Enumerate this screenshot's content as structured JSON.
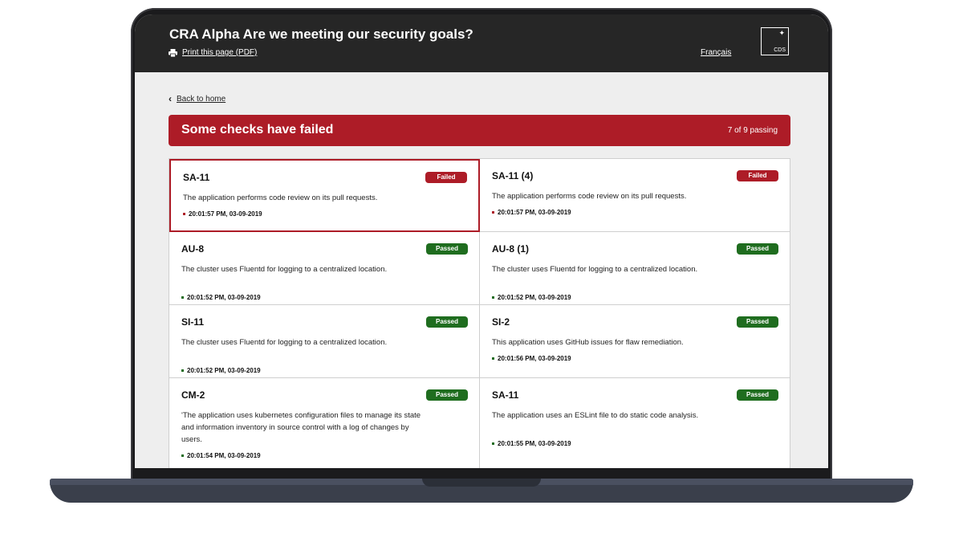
{
  "header": {
    "title": "CRA Alpha Are we meeting our security goals?",
    "print_label": "Print this page (PDF)",
    "language_link": "Français",
    "logo_text": "CDS"
  },
  "nav": {
    "back_label": "Back to home"
  },
  "banner": {
    "title": "Some checks have failed",
    "count": "7 of 9 passing",
    "color": "#ad1c27"
  },
  "status_colors": {
    "failed": "#ad1c27",
    "passed": "#1f6d1f"
  },
  "checks": [
    {
      "name": "SA-11",
      "status": "Failed",
      "description": "The application performs code review on its pull requests.",
      "timestamp": "20:01:57 PM, 03-09-2019"
    },
    {
      "name": "SA-11 (4)",
      "status": "Failed",
      "description": "The application performs code review on its pull requests.",
      "timestamp": "20:01:57 PM, 03-09-2019"
    },
    {
      "name": "AU-8",
      "status": "Passed",
      "description": "The cluster uses Fluentd for logging to a centralized location.",
      "timestamp": "20:01:52 PM, 03-09-2019"
    },
    {
      "name": "AU-8 (1)",
      "status": "Passed",
      "description": "The cluster uses Fluentd for logging to a centralized location.",
      "timestamp": "20:01:52 PM, 03-09-2019"
    },
    {
      "name": "SI-11",
      "status": "Passed",
      "description": "The cluster uses Fluentd for logging to a centralized location.",
      "timestamp": "20:01:52 PM, 03-09-2019"
    },
    {
      "name": "SI-2",
      "status": "Passed",
      "description": "This application uses GitHub issues for flaw remediation.",
      "timestamp": "20:01:56 PM, 03-09-2019"
    },
    {
      "name": "CM-2",
      "status": "Passed",
      "description": "'The application uses kubernetes configuration files to manage its state and information inventory in source control with a log of changes by users.",
      "timestamp": "20:01:54 PM, 03-09-2019"
    },
    {
      "name": "SA-11",
      "status": "Passed",
      "description": "The application uses an ESLint file to do static code analysis.",
      "timestamp": "20:01:55 PM, 03-09-2019"
    }
  ]
}
